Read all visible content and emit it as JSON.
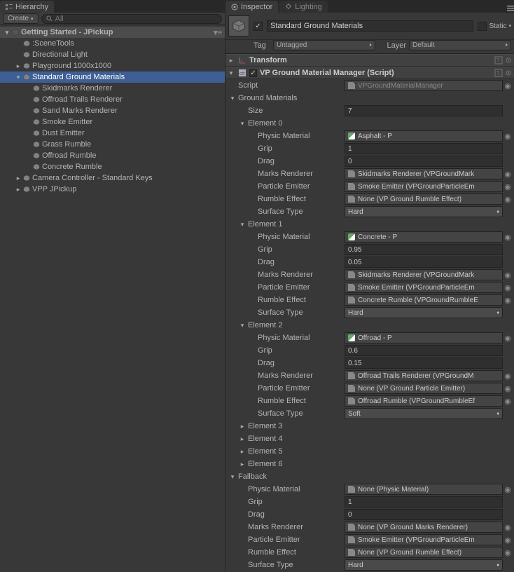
{
  "hierarchy": {
    "tab": "Hierarchy",
    "create_label": "Create",
    "search_placeholder": "All",
    "root": "Getting Started - JPickup",
    "items": [
      {
        "label": ":SceneTools",
        "depth": 1,
        "expand": false
      },
      {
        "label": "Directional Light",
        "depth": 1,
        "expand": false
      },
      {
        "label": "Playground 1000x1000",
        "depth": 1,
        "expand": true,
        "collapsed": true
      },
      {
        "label": "Standard Ground Materials",
        "depth": 1,
        "expand": true,
        "collapsed": false,
        "selected": true
      },
      {
        "label": "Skidmarks Renderer",
        "depth": 2
      },
      {
        "label": "Offroad Trails Renderer",
        "depth": 2
      },
      {
        "label": "Sand Marks Renderer",
        "depth": 2
      },
      {
        "label": "Smoke Emitter",
        "depth": 2
      },
      {
        "label": "Dust Emitter",
        "depth": 2
      },
      {
        "label": "Grass Rumble",
        "depth": 2
      },
      {
        "label": "Offroad Rumble",
        "depth": 2
      },
      {
        "label": "Concrete Rumble",
        "depth": 2
      },
      {
        "label": "Camera Controller - Standard Keys",
        "depth": 1,
        "expand": true,
        "collapsed": true
      },
      {
        "label": "VPP JPickup",
        "depth": 1,
        "expand": true,
        "collapsed": true
      }
    ]
  },
  "inspector": {
    "tabs": {
      "inspector": "Inspector",
      "lighting": "Lighting"
    },
    "object_name": "Standard Ground Materials",
    "static_label": "Static",
    "tag_label": "Tag",
    "tag_value": "Untagged",
    "layer_label": "Layer",
    "layer_value": "Default",
    "transform_label": "Transform",
    "component": {
      "title": "VP Ground Material Manager (Script)",
      "script_label": "Script",
      "script_value": "VPGroundMaterialManager",
      "gm_header": "Ground Materials",
      "size_label": "Size",
      "size_value": "7",
      "elements": [
        {
          "name": "Element 0",
          "open": true,
          "physic": "Asphalt - P",
          "grip": "1",
          "drag": "0",
          "marks": "Skidmarks Renderer (VPGroundMark",
          "particle": "Smoke Emitter (VPGroundParticleEm",
          "rumble": "None (VP Ground Rumble Effect)",
          "surface": "Hard"
        },
        {
          "name": "Element 1",
          "open": true,
          "physic": "Concrete - P",
          "grip": "0.95",
          "drag": "0.05",
          "marks": "Skidmarks Renderer (VPGroundMark",
          "particle": "Smoke Emitter (VPGroundParticleEm",
          "rumble": "Concrete Rumble (VPGroundRumbleE",
          "surface": "Hard"
        },
        {
          "name": "Element 2",
          "open": true,
          "physic": "Offroad - P",
          "grip": "0.6",
          "drag": "0.15",
          "marks": "Offroad Trails Renderer (VPGroundM",
          "particle": "None (VP Ground Particle Emitter)",
          "rumble": "Offroad Rumble (VPGroundRumbleEf",
          "surface": "Soft"
        },
        {
          "name": "Element 3",
          "open": false
        },
        {
          "name": "Element 4",
          "open": false
        },
        {
          "name": "Element 5",
          "open": false
        },
        {
          "name": "Element 6",
          "open": false
        }
      ],
      "fallback": {
        "name": "Fallback",
        "open": true,
        "physic": "None (Physic Material)",
        "physic_none": true,
        "grip": "1",
        "drag": "0",
        "marks": "None (VP Ground Marks Renderer)",
        "particle": "Smoke Emitter (VPGroundParticleEm",
        "rumble": "None (VP Ground Rumble Effect)",
        "surface": "Hard"
      },
      "labels": {
        "physic": "Physic Material",
        "grip": "Grip",
        "drag": "Drag",
        "marks": "Marks Renderer",
        "particle": "Particle Emitter",
        "rumble": "Rumble Effect",
        "surface": "Surface Type"
      }
    }
  }
}
